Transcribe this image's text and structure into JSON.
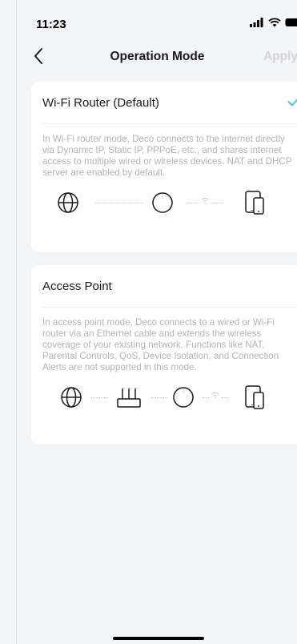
{
  "status": {
    "time": "11:23"
  },
  "nav": {
    "title": "Operation Mode",
    "apply_label": "Apply"
  },
  "options": [
    {
      "label": "Wi-Fi Router (Default)",
      "selected": true,
      "description": "In Wi-Fi router mode, Deco connects to the internet directly via Dynamic IP, Static IP, PPPoE, etc., and shares internet access to multiple wired or wireless devices. NAT and DHCP server are enabled by default.",
      "diagram": [
        "globe-icon",
        "deco-icon",
        "wifi-icon",
        "devices-icon"
      ]
    },
    {
      "label": "Access Point",
      "selected": false,
      "description": "In access point mode, Deco connects to a wired or Wi-Fi router via an Ethernet cable and extends the wireless coverage of your existing network. Functions like NAT, Parental Controls, QoS, Device Isolation, and Connection Alerts are not supported in this mode.",
      "diagram": [
        "globe-icon",
        "router-icon",
        "deco-icon",
        "wifi-icon",
        "devices-icon"
      ]
    }
  ],
  "colors": {
    "accent": "#4fc3d9",
    "muted_text": "#b4b4b8",
    "disabled": "#d4d4d7"
  }
}
